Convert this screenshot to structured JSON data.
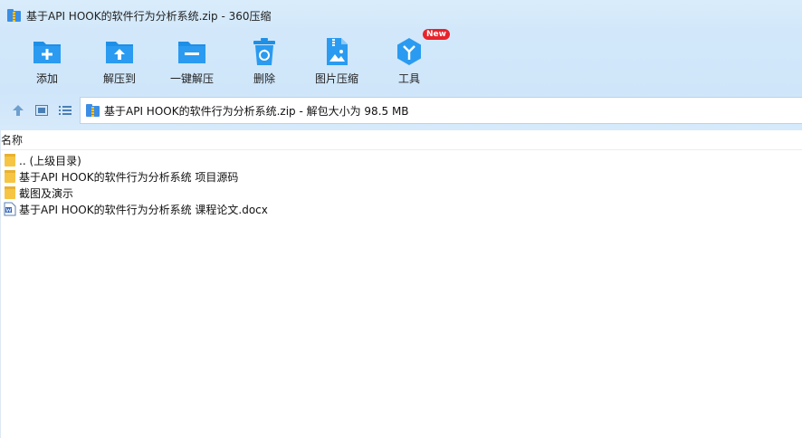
{
  "window": {
    "title": "基于API HOOK的软件行为分析系统.zip - 360压缩"
  },
  "toolbar": {
    "items": [
      {
        "label": "添加",
        "icon": "add-folder-icon"
      },
      {
        "label": "解压到",
        "icon": "extract-to-icon"
      },
      {
        "label": "一键解压",
        "icon": "one-click-extract-icon"
      },
      {
        "label": "删除",
        "icon": "recycle-bin-icon"
      },
      {
        "label": "图片压缩",
        "icon": "image-compress-icon"
      },
      {
        "label": "工具",
        "icon": "tools-icon",
        "badge": "New"
      }
    ]
  },
  "navbar": {
    "path": "基于API HOOK的软件行为分析系统.zip - 解包大小为 98.5 MB"
  },
  "list": {
    "column_name": "名称",
    "files": [
      {
        "name": ".. (上级目录)",
        "icon": "folder-icon"
      },
      {
        "name": "基于API HOOK的软件行为分析系统 项目源码",
        "icon": "folder-icon"
      },
      {
        "name": "截图及演示",
        "icon": "folder-icon"
      },
      {
        "name": "基于API HOOK的软件行为分析系统 课程论文.docx",
        "icon": "word-doc-icon"
      }
    ]
  },
  "colors": {
    "accent": "#1e8fe6",
    "titlebar_bg": "#d9ecfb",
    "folder": "#f6c543",
    "badge": "#e8232b"
  }
}
